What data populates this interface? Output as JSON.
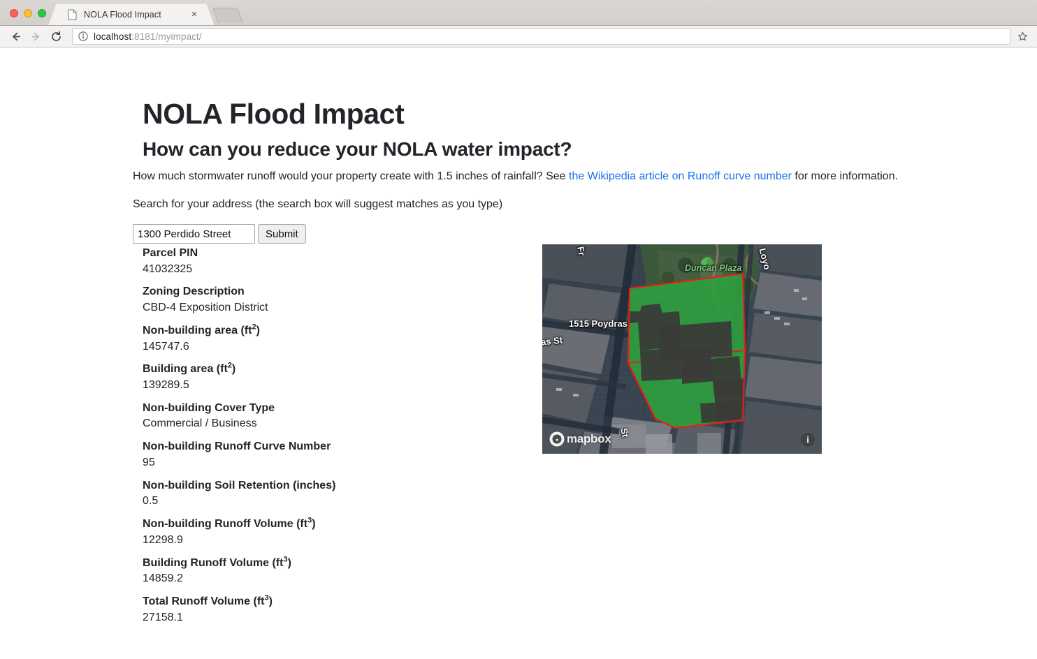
{
  "browser": {
    "tab_title": "NOLA Flood Impact",
    "close_label": "×",
    "url_host": "localhost",
    "url_path": ":8181/myimpact/",
    "icons": {
      "back": "back-arrow-icon",
      "forward": "forward-arrow-icon",
      "reload": "reload-icon",
      "site_info": "info-circle-icon",
      "bookmark": "star-icon",
      "new_tab": "new-tab-button",
      "page": "page-icon"
    }
  },
  "page": {
    "title": "NOLA Flood Impact",
    "subtitle": "How can you reduce your NOLA water impact?",
    "lede_before": "How much stormwater runoff would your property create with 1.5 inches of rainfall? See ",
    "lede_link": "the Wikipedia article on Runoff curve number",
    "lede_after": " for more information.",
    "search_note": "Search for your address (the search box will suggest matches as you type)",
    "link_color": "#1a73e8"
  },
  "search": {
    "value": "1300 Perdido Street",
    "placeholder": "",
    "submit_label": "Submit"
  },
  "results": [
    {
      "label": "Parcel PIN",
      "sup": "",
      "value": "41032325"
    },
    {
      "label": "Zoning Description",
      "sup": "",
      "value": "CBD-4 Exposition District"
    },
    {
      "label": "Non-building area (ft",
      "sup": "2",
      "value": "145747.6"
    },
    {
      "label": "Building area (ft",
      "sup": "2",
      "value": "139289.5"
    },
    {
      "label": "Non-building Cover Type",
      "sup": "",
      "value": "Commercial / Business"
    },
    {
      "label": "Non-building Runoff Curve Number",
      "sup": "",
      "value": "95"
    },
    {
      "label": "Non-building Soil Retention (inches)",
      "sup": "",
      "value": "0.5"
    },
    {
      "label": "Non-building Runoff Volume (ft",
      "sup": "3",
      "value": "12298.9"
    },
    {
      "label": "Building Runoff Volume (ft",
      "sup": "3",
      "value": "14859.2"
    },
    {
      "label": "Total Runoff Volume (ft",
      "sup": "3",
      "value": "27158.1"
    }
  ],
  "map": {
    "provider": "mapbox",
    "attribution_label": "mapbox",
    "info_label": "i",
    "parcel_outline_color": "#ef1b13",
    "parcel_fill_color": "#2e9e3e",
    "building_fill_color": "#3a3a38",
    "labels": [
      {
        "name": "Duncan Plaza",
        "type": "park"
      },
      {
        "name": "1515 Poydras",
        "type": "street"
      },
      {
        "name": "as St",
        "type": "street"
      },
      {
        "name": "Loyo",
        "type": "street"
      },
      {
        "name": "Fr",
        "type": "street"
      },
      {
        "name": "St",
        "type": "street"
      }
    ]
  }
}
